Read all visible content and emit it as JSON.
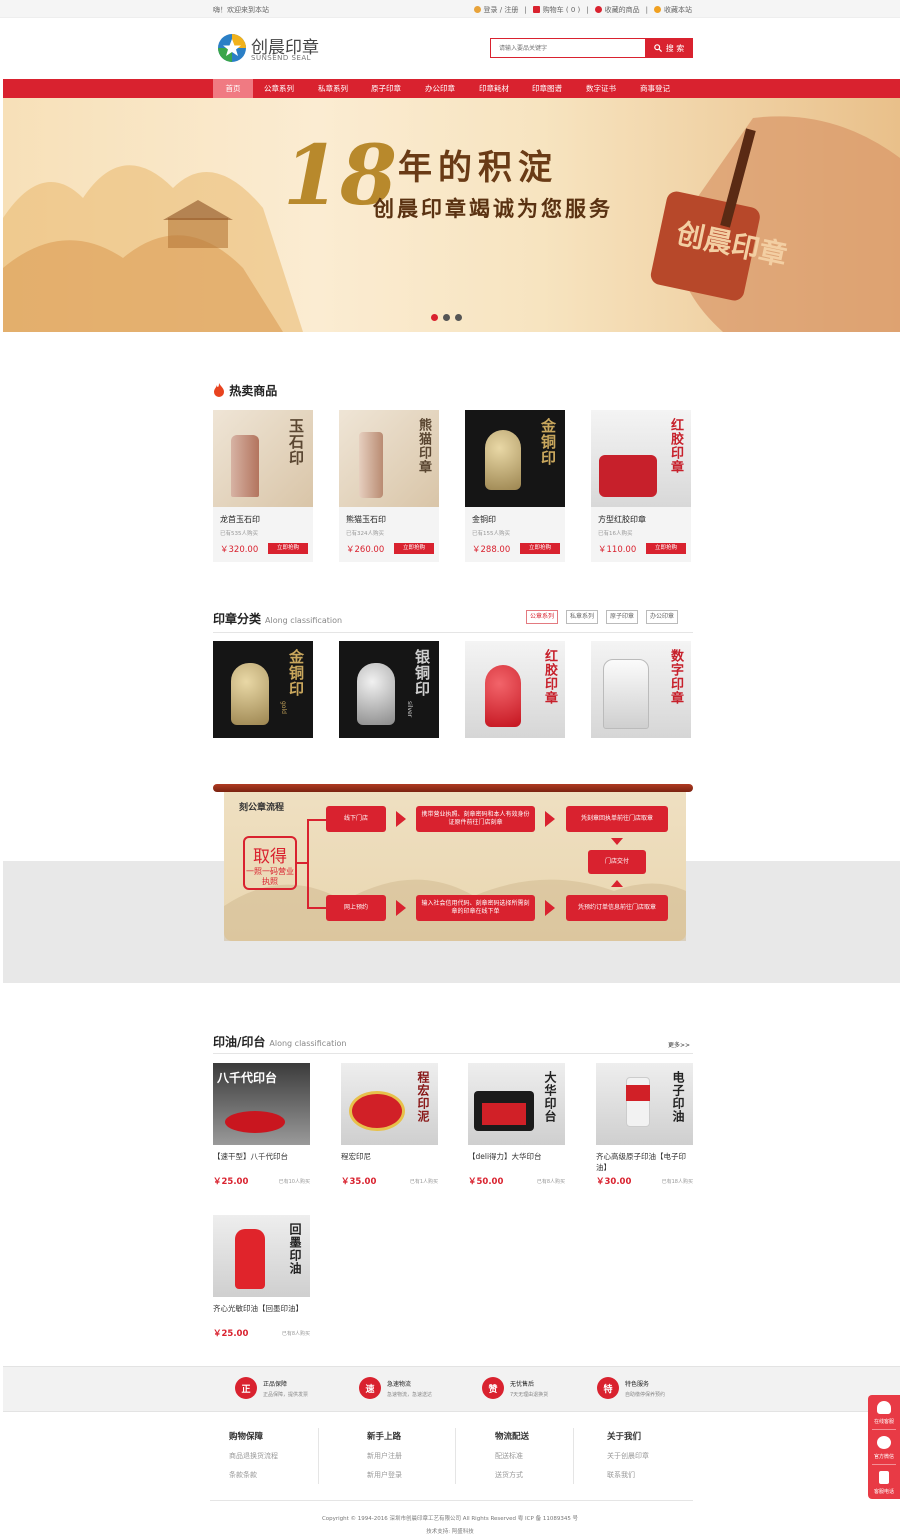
{
  "topbar": {
    "welcome": "嗨！欢迎来到本站",
    "login": "登录 / 注册",
    "cart": "购物车 ( 0 )",
    "fav_products": "收藏的商品",
    "fav_site": "收藏本站"
  },
  "header": {
    "logo_cn": "创晨印章",
    "logo_en": "SUNSEND SEAL",
    "search_placeholder": "请输入要品关键字",
    "search_button": "搜 索"
  },
  "nav": [
    "首页",
    "公章系列",
    "私章系列",
    "原子印章",
    "办公印章",
    "印章耗材",
    "印章图谱",
    "数字证书",
    "商事登记"
  ],
  "banner": {
    "number": "18",
    "line1": "年的积淀",
    "line2": "创晨印章竭诚为您服务",
    "stamp_text": "创晨印章",
    "dots": 3,
    "active_dot": 0
  },
  "hot": {
    "title": "热卖商品",
    "buy_label": "立即抢购",
    "items": [
      {
        "name": "龙首玉石印",
        "sold": "已有535人购买",
        "price": "￥320.00",
        "img_text": "玉石印"
      },
      {
        "name": "熊猫玉石印",
        "sold": "已有324人购买",
        "price": "￥260.00",
        "img_text": "熊猫印章"
      },
      {
        "name": "金铜印",
        "sold": "已有155人购买",
        "price": "￥288.00",
        "img_text": "金铜印"
      },
      {
        "name": "方型红胶印章",
        "sold": "已有16人购买",
        "price": "￥110.00",
        "img_text": "红胶印章"
      }
    ]
  },
  "category": {
    "title": "印章分类",
    "subtitle": "Along classification",
    "tabs": [
      "公章系列",
      "私章系列",
      "原子印章",
      "办公印章"
    ],
    "active_tab": 0,
    "items": [
      {
        "img_text": "金铜印",
        "tag": "gold"
      },
      {
        "img_text": "银铜印",
        "tag": "silver"
      },
      {
        "img_text": "红胶印章",
        "tag": ""
      },
      {
        "img_text": "数字印章",
        "tag": ""
      }
    ]
  },
  "flow": {
    "title": "刻公章流程",
    "big_main": "取得",
    "big_sub": "一照一码营业执照",
    "offline": "线下门店",
    "offline_step": "携带营业执照、刻章密码和本人有效身份证原件前往门店刻章",
    "offline_pickup": "凭刻章回执单前往门店取章",
    "store": "门店交付",
    "online": "网上预约",
    "online_step": "输入社会信用代码、刻章密码选择所需刻章的印章在线下单",
    "online_pickup": "凭预约订单信息前往门店取章"
  },
  "ink": {
    "title": "印油/印台",
    "subtitle": "Along classification",
    "more": "更多>>",
    "items": [
      {
        "name": "【速干型】八千代印台",
        "price": "￥25.00",
        "sold": "已有10人购买",
        "img_text": "八千代印台"
      },
      {
        "name": "程宏印尼",
        "price": "￥35.00",
        "sold": "已有1人购买",
        "img_text": "程宏印泥"
      },
      {
        "name": "【deli得力】大华印台",
        "price": "￥50.00",
        "sold": "已有8人购买",
        "img_text": "大华印台"
      },
      {
        "name": "齐心高级原子印油【电子印油】",
        "price": "￥30.00",
        "sold": "已有18人购买",
        "img_text": "电子印油"
      },
      {
        "name": "齐心光敏印油【回墨印油】",
        "price": "￥25.00",
        "sold": "已有8人购买",
        "img_text": "回墨印油"
      }
    ]
  },
  "guarantee": [
    {
      "icon": "正",
      "title": "正品保障",
      "sub": "正品保障，提供发票"
    },
    {
      "icon": "速",
      "title": "急速物流",
      "sub": "急速物流，急速送达"
    },
    {
      "icon": "赞",
      "title": "无忧售后",
      "sub": "7天无理由退换货"
    },
    {
      "icon": "特",
      "title": "特色服务",
      "sub": "自助缴停保养预约"
    }
  ],
  "footer": {
    "cols": [
      {
        "title": "购物保障",
        "links": [
          "商品退换货流程",
          "条款条款"
        ]
      },
      {
        "title": "新手上路",
        "links": [
          "新用户注册",
          "新用户登录"
        ]
      },
      {
        "title": "物流配送",
        "links": [
          "配送标准",
          "送货方式"
        ]
      },
      {
        "title": "关于我们",
        "links": [
          "关于创晨印章",
          "联系我们"
        ]
      }
    ],
    "copyright": "Copyright © 1994-2016  深圳市创晨印章工艺有限公司  All Rights Reserved  粤 ICP 备 11089345 号",
    "support": "技术支持: 阿盛科技"
  },
  "side": [
    "在线客服",
    "官方微信",
    "客服电话"
  ],
  "colors": {
    "brand": "#d9222f",
    "nav_active": "#f07a82"
  }
}
